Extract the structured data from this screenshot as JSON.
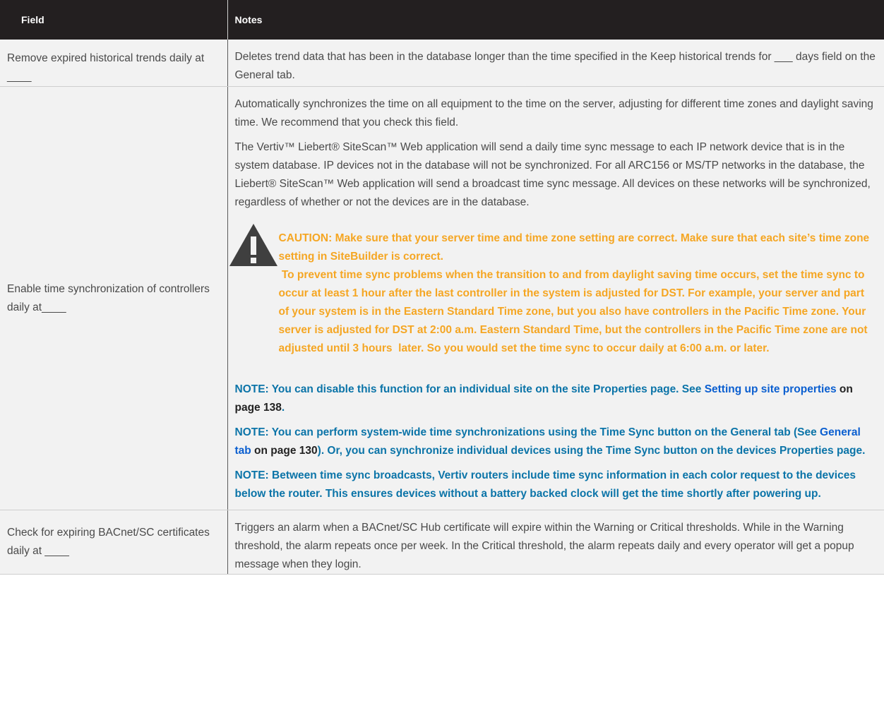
{
  "header": {
    "col1": "Field",
    "col2": "Notes"
  },
  "rows": [
    {
      "field": "Remove expired historical trends daily at ____",
      "notes": "Deletes trend data that has been in the database longer than the time specified in the Keep historical trends for ___ days field on the General tab."
    },
    {
      "field": "Enable time synchronization of controllers daily at____",
      "para1": "Automatically synchronizes the time on all equipment to the time on the server, adjusting for different time zones and daylight saving time. We recommend that you check this field.",
      "para2": "The Vertiv™ Liebert® SiteScan™ Web application will send a daily time sync message to each IP network device that is in the system database. IP devices not in the database will not be synchronized. For all ARC156 or MS/TP networks in the database, the Liebert® SiteScan™ Web application will send a broadcast time sync message. All devices on these networks will be synchronized, regardless of whether or not the devices are in the database.",
      "caution_icon": "warning-triangle-icon",
      "caution_line1": "CAUTION: Make sure that your server time and time zone setting are correct. Make sure that each site’s time zone setting in SiteBuilder is correct.",
      "caution_line2": " To prevent time sync problems when the transition to and from daylight saving time occurs, set the time sync to occur at least 1 hour after the last controller in the system is adjusted for DST. For example, your server and part of your system is in the Eastern Standard Time zone, but you also have controllers in the Pacific Time zone. Your server is adjusted for DST at 2:00 a.m. Eastern Standard Time, but the controllers in the Pacific Time zone are not adjusted until 3 hours  later. So you would set the time sync to occur daily at 6:00 a.m. or later.",
      "note1_pre": "NOTE: You can disable this function for an individual site on the site Properties page. See ",
      "note1_link": "Setting up site properties",
      "note1_page": " on page 138",
      "note1_post": ".",
      "note2_pre": "NOTE: You can perform system-wide time synchronizations using the Time Sync button on the General tab (See ",
      "note2_link": "General tab",
      "note2_page": " on page 130",
      "note2_post": "). Or, you can synchronize individual devices using the Time Sync button on the devices Properties page.",
      "note3": "NOTE: Between time sync broadcasts, Vertiv routers include time sync information in each color request to the devices below the router. This ensures devices without a battery backed clock will get the time shortly after powering up."
    },
    {
      "field": "Check for expiring BACnet/SC certificates daily at ____",
      "notes": "Triggers an alarm when a BACnet/SC Hub certificate will expire within the Warning or Critical thresholds. While in the Warning threshold, the alarm repeats once per week. In the Critical threshold, the alarm repeats daily and every operator will get a popup message when they login."
    }
  ],
  "colors": {
    "header_bg": "#231f20",
    "row_bg": "#f2f2f2",
    "caution": "#f5a623",
    "note": "#0b74a8",
    "link": "#0b5fd0"
  }
}
